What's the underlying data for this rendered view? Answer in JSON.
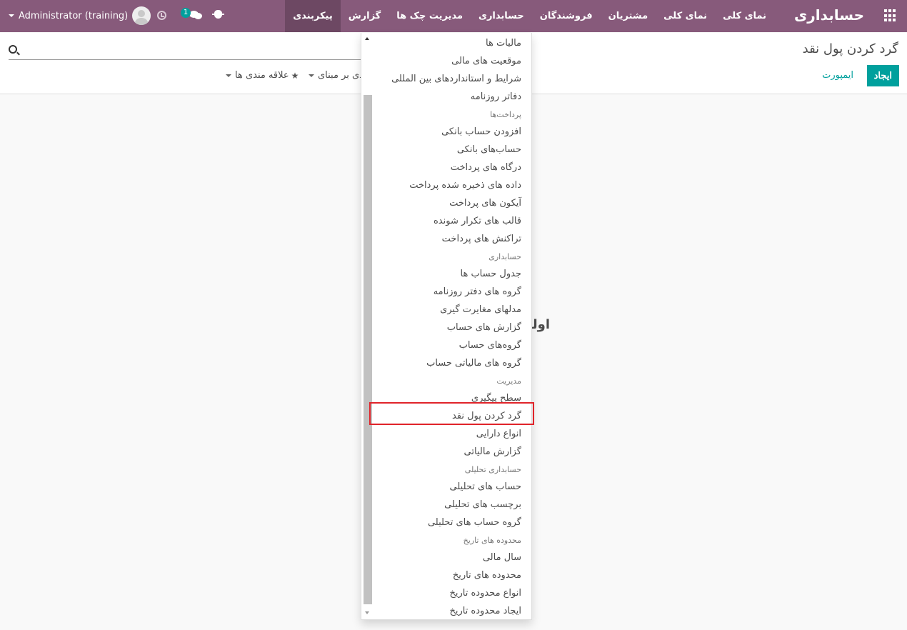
{
  "navbar": {
    "brand": "حسابداری",
    "menu": [
      {
        "label": "نمای کلی",
        "active": false
      },
      {
        "label": "نمای کلی",
        "active": false
      },
      {
        "label": "مشتریان",
        "active": false
      },
      {
        "label": "فروشندگان",
        "active": false
      },
      {
        "label": "حسابداری",
        "active": false
      },
      {
        "label": "مدیریت چک ها",
        "active": false
      },
      {
        "label": "گزارش",
        "active": false
      },
      {
        "label": "پیکربندی",
        "active": true
      }
    ],
    "user": "Administrator (training)",
    "message_count": "1"
  },
  "control_panel": {
    "breadcrumb": "گرد کردن پول نقد",
    "create_label": "ایجاد",
    "import_label": "ایمپورت",
    "favorites_label": "علاقه مندی ها",
    "groupby_label": "گروه بندی بر مبنای"
  },
  "content": {
    "hint_partial": "اولین"
  },
  "dropdown": {
    "items": [
      {
        "type": "item",
        "label": "مالیات ها"
      },
      {
        "type": "item",
        "label": "موقعیت های مالی"
      },
      {
        "type": "item",
        "label": "شرایط و استانداردهای بین المللی"
      },
      {
        "type": "item",
        "label": "دفاتر روزنامه"
      },
      {
        "type": "header",
        "label": "پرداخت‌ها"
      },
      {
        "type": "item",
        "label": "افزودن حساب بانکی"
      },
      {
        "type": "item",
        "label": "حساب‌های بانکی"
      },
      {
        "type": "item",
        "label": "درگاه های پرداخت"
      },
      {
        "type": "item",
        "label": "داده های ذخیره شده پرداخت"
      },
      {
        "type": "item",
        "label": "آیکون های پرداخت"
      },
      {
        "type": "item",
        "label": "قالب های تکرار شونده"
      },
      {
        "type": "item",
        "label": "تراکنش های پرداخت"
      },
      {
        "type": "header",
        "label": "حسابداری"
      },
      {
        "type": "item",
        "label": "جدول حساب ها"
      },
      {
        "type": "item",
        "label": "گروه های دفتر روزنامه"
      },
      {
        "type": "item",
        "label": "مدلهای مغایرت گیری"
      },
      {
        "type": "item",
        "label": "گزارش های حساب"
      },
      {
        "type": "item",
        "label": "گروه‌های حساب"
      },
      {
        "type": "item",
        "label": "گروه های مالیاتی حساب"
      },
      {
        "type": "header",
        "label": "مدیریت"
      },
      {
        "type": "item",
        "label": "سطح پیگیری"
      },
      {
        "type": "item",
        "label": "گرد کردن پول نقد",
        "selected": true
      },
      {
        "type": "item",
        "label": "انواع دارایی"
      },
      {
        "type": "item",
        "label": "گزارش مالیاتی"
      },
      {
        "type": "header",
        "label": "حسابداری تحلیلی"
      },
      {
        "type": "item",
        "label": "حساب های تحلیلی"
      },
      {
        "type": "item",
        "label": "برچسب های تحلیلی"
      },
      {
        "type": "item",
        "label": "گروه حساب های تحلیلی"
      },
      {
        "type": "header",
        "label": "محدوده های تاریخ"
      },
      {
        "type": "item",
        "label": "سال مالی"
      },
      {
        "type": "item",
        "label": "محدوده های تاریخ"
      },
      {
        "type": "item",
        "label": "انواع محدوده تاریخ"
      },
      {
        "type": "item",
        "label": "ایجاد محدوده تاریخ"
      }
    ]
  }
}
